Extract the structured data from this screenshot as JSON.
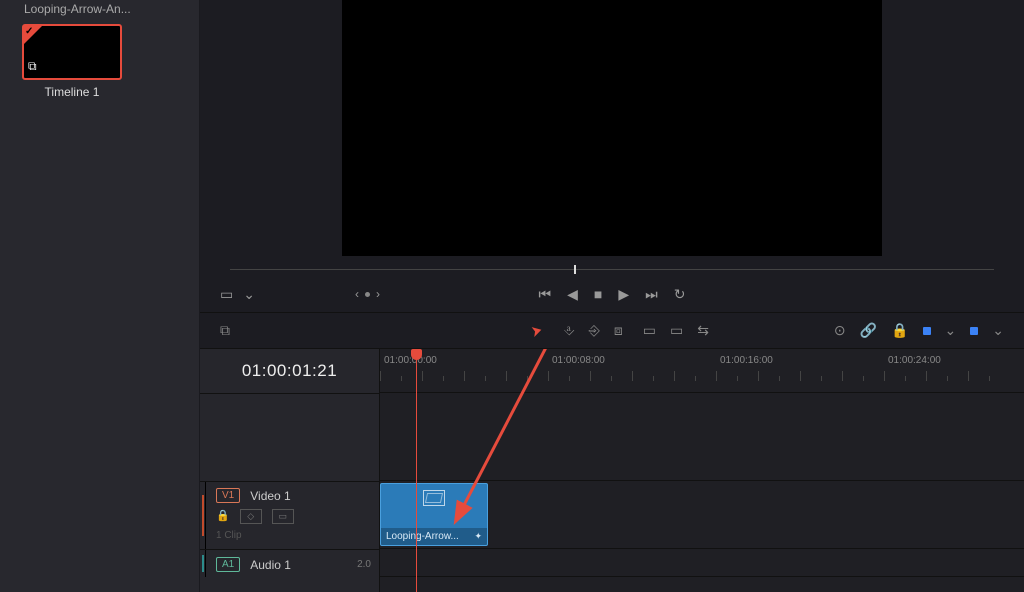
{
  "sidebar": {
    "bin_filename": "Looping-Arrow-An...",
    "thumb_label": "Timeline 1"
  },
  "transport": {
    "crop_glyph": "▭",
    "chev_down": "⌄",
    "prev_glyph": "⏮",
    "play_back": "◀",
    "stop_glyph": "■",
    "play_fwd": "▶",
    "next_glyph": "⏭",
    "loop_glyph": "↻"
  },
  "timecode": "01:00:01:21",
  "ruler": {
    "ticks": [
      "01:00:00:00",
      "01:00:08:00",
      "01:00:16:00",
      "01:00:24:00"
    ]
  },
  "tracks": {
    "video1": {
      "tag": "V1",
      "name": "Video 1",
      "lock_glyph": "🔒",
      "clip_count": "1 Clip"
    },
    "audio1": {
      "tag": "A1",
      "name": "Audio 1",
      "db": "2.0"
    }
  },
  "clip": {
    "label": "Looping-Arrow...",
    "fx": "✦"
  }
}
